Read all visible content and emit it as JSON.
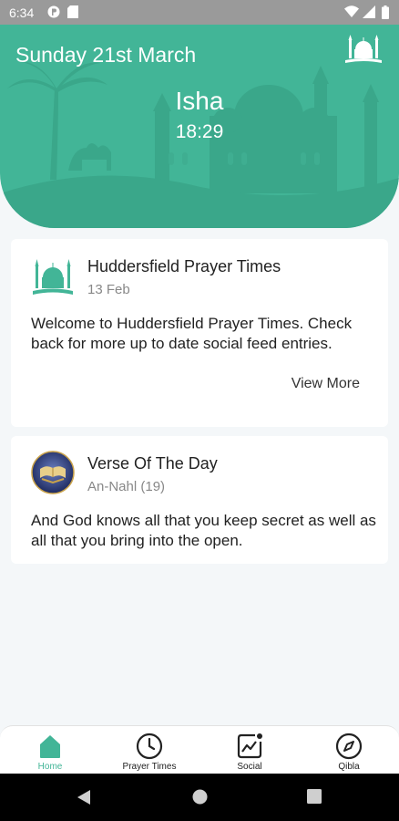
{
  "status_bar": {
    "time": "6:34"
  },
  "header": {
    "date": "Sunday 21st March",
    "prayer_name": "Isha",
    "prayer_time": "18:29"
  },
  "feed": {
    "title": "Huddersfield Prayer Times",
    "date": "13 Feb",
    "body": "Welcome to Huddersfield Prayer Times. Check back for more up to date social feed entries.",
    "view_more": "View More"
  },
  "verse": {
    "title": "Verse Of The Day",
    "reference": "An-Nahl (19)",
    "body": "And God knows all that you keep secret as well as all that you bring into the open."
  },
  "nav": {
    "items": [
      {
        "label": "Home",
        "icon": "home-icon",
        "active": true
      },
      {
        "label": "Prayer Times",
        "icon": "clock-icon",
        "active": false
      },
      {
        "label": "Social",
        "icon": "social-icon",
        "active": false
      },
      {
        "label": "Qibla",
        "icon": "compass-icon",
        "active": false
      }
    ]
  },
  "colors": {
    "accent": "#42b597",
    "status_bar": "#9a9a9a",
    "background": "#f4f7f9"
  }
}
